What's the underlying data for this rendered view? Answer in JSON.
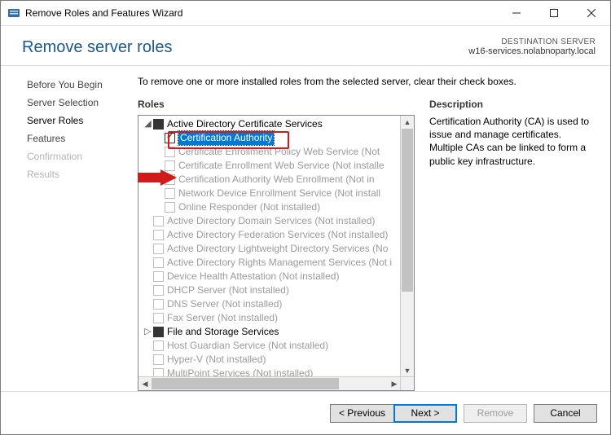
{
  "window": {
    "title": "Remove Roles and Features Wizard"
  },
  "header": {
    "heading": "Remove server roles",
    "destination_label": "DESTINATION SERVER",
    "destination_server": "w16-services.nolabnoparty.local"
  },
  "nav": {
    "items": [
      {
        "label": "Before You Begin",
        "state": "normal"
      },
      {
        "label": "Server Selection",
        "state": "normal"
      },
      {
        "label": "Server Roles",
        "state": "selected"
      },
      {
        "label": "Features",
        "state": "normal"
      },
      {
        "label": "Confirmation",
        "state": "disabled"
      },
      {
        "label": "Results",
        "state": "disabled"
      }
    ]
  },
  "main": {
    "instruction": "To remove one or more installed roles from the selected server, clear their check boxes.",
    "roles_header": "Roles",
    "description_header": "Description",
    "description_text": "Certification Authority (CA) is used to issue and manage certificates. Multiple CAs can be linked to form a public key infrastructure.",
    "tree": [
      {
        "level": 1,
        "expander": "open",
        "check": "filled",
        "label": "Active Directory Certificate Services",
        "disabled": false,
        "highlight": false
      },
      {
        "level": 2,
        "expander": "none",
        "check": "checked",
        "label": "Certification Authority",
        "disabled": false,
        "highlight": true
      },
      {
        "level": 2,
        "expander": "none",
        "check": "empty",
        "label": "Certificate Enrollment Policy Web Service (Not",
        "disabled": true,
        "highlight": false
      },
      {
        "level": 2,
        "expander": "none",
        "check": "empty",
        "label": "Certificate Enrollment Web Service (Not installe",
        "disabled": true,
        "highlight": false
      },
      {
        "level": 2,
        "expander": "none",
        "check": "empty",
        "label": "Certification Authority Web Enrollment (Not in",
        "disabled": true,
        "highlight": false
      },
      {
        "level": 2,
        "expander": "none",
        "check": "empty",
        "label": "Network Device Enrollment Service (Not install",
        "disabled": true,
        "highlight": false
      },
      {
        "level": 2,
        "expander": "none",
        "check": "empty",
        "label": "Online Responder (Not installed)",
        "disabled": true,
        "highlight": false
      },
      {
        "level": 1,
        "expander": "none",
        "check": "empty",
        "label": "Active Directory Domain Services (Not installed)",
        "disabled": true,
        "highlight": false
      },
      {
        "level": 1,
        "expander": "none",
        "check": "empty",
        "label": "Active Directory Federation Services (Not installed)",
        "disabled": true,
        "highlight": false
      },
      {
        "level": 1,
        "expander": "none",
        "check": "empty",
        "label": "Active Directory Lightweight Directory Services (No",
        "disabled": true,
        "highlight": false
      },
      {
        "level": 1,
        "expander": "none",
        "check": "empty",
        "label": "Active Directory Rights Management Services (Not i",
        "disabled": true,
        "highlight": false
      },
      {
        "level": 1,
        "expander": "none",
        "check": "empty",
        "label": "Device Health Attestation (Not installed)",
        "disabled": true,
        "highlight": false
      },
      {
        "level": 1,
        "expander": "none",
        "check": "empty",
        "label": "DHCP Server (Not installed)",
        "disabled": true,
        "highlight": false
      },
      {
        "level": 1,
        "expander": "none",
        "check": "empty",
        "label": "DNS Server (Not installed)",
        "disabled": true,
        "highlight": false
      },
      {
        "level": 1,
        "expander": "none",
        "check": "empty",
        "label": "Fax Server (Not installed)",
        "disabled": true,
        "highlight": false
      },
      {
        "level": 1,
        "expander": "closed",
        "check": "filled",
        "label": "File and Storage Services",
        "disabled": false,
        "highlight": false
      },
      {
        "level": 1,
        "expander": "none",
        "check": "empty",
        "label": "Host Guardian Service (Not installed)",
        "disabled": true,
        "highlight": false
      },
      {
        "level": 1,
        "expander": "none",
        "check": "empty",
        "label": "Hyper-V (Not installed)",
        "disabled": true,
        "highlight": false
      },
      {
        "level": 1,
        "expander": "none",
        "check": "empty",
        "label": "MultiPoint Services (Not installed)",
        "disabled": true,
        "highlight": false
      }
    ]
  },
  "buttons": {
    "previous": "< Previous",
    "next": "Next >",
    "remove": "Remove",
    "cancel": "Cancel"
  }
}
